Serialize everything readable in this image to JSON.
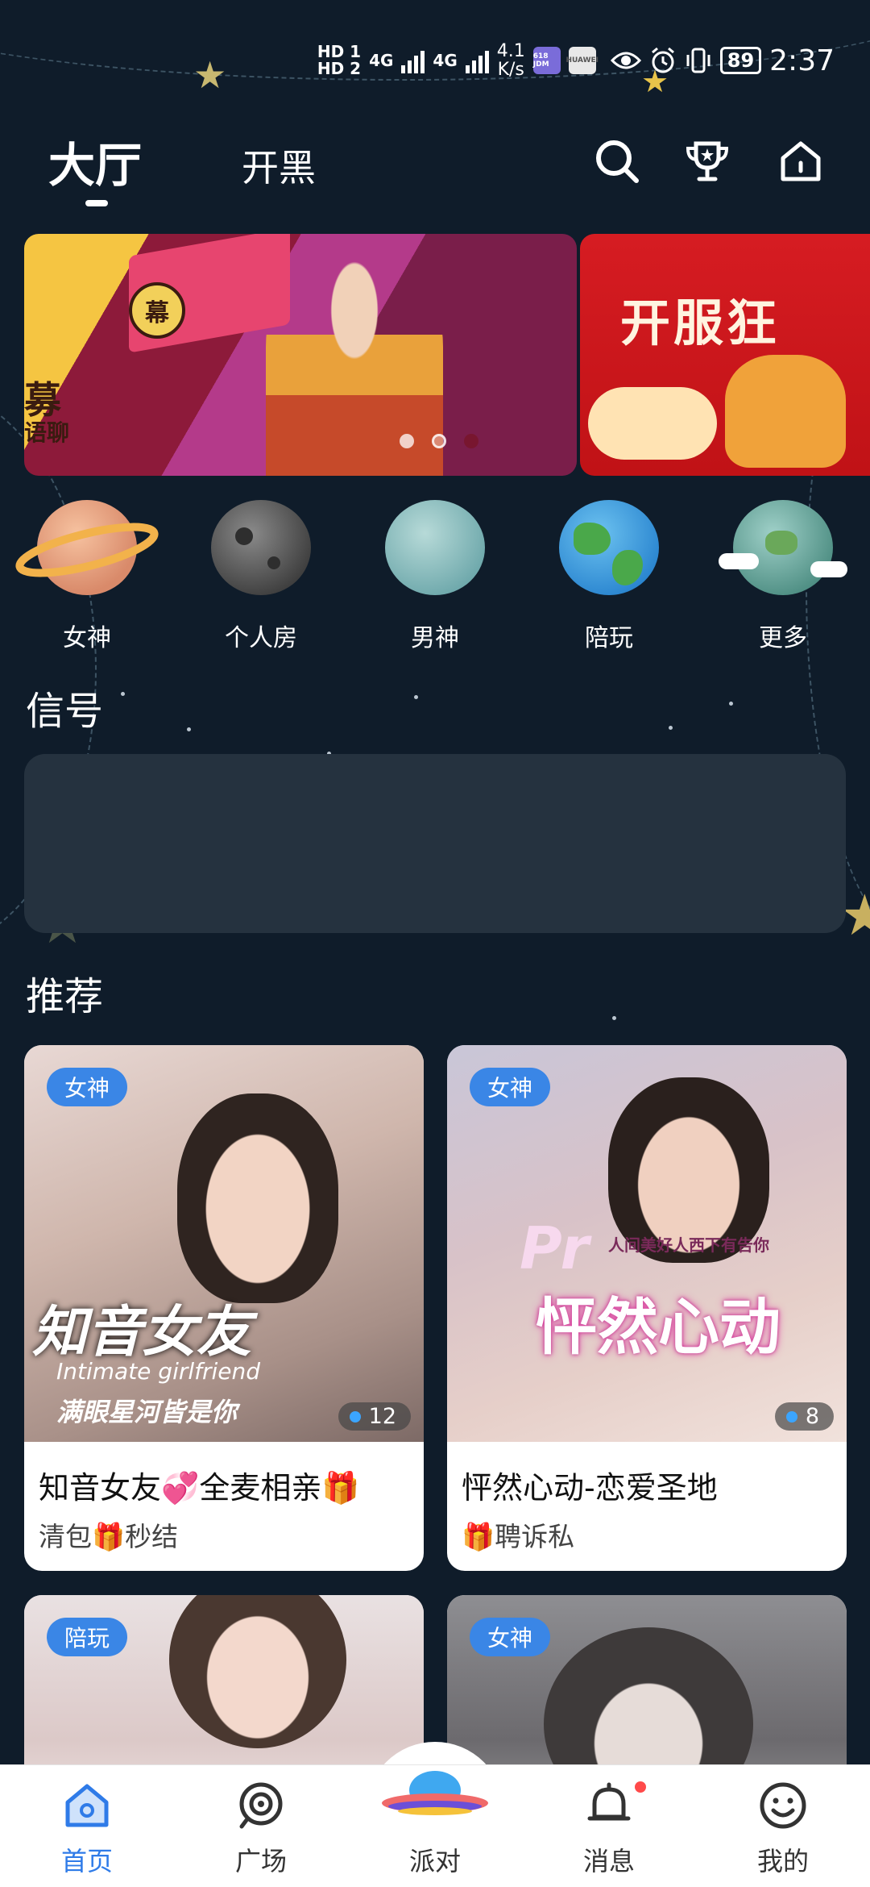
{
  "status_bar": {
    "hd1": "HD 1",
    "hd2": "HD 2",
    "net1": "4G",
    "net2": "4G",
    "speed_value": "4.1",
    "speed_unit": "K/s",
    "app1": "618 JDM",
    "app2": "HUAWEI",
    "battery": "89",
    "time": "2:37"
  },
  "top_tabs": {
    "active": "大厅",
    "second": "开黑"
  },
  "banner": {
    "main_text1": "募",
    "main_text2": "语聊",
    "main_badge": "幕",
    "next_text": "开服狂"
  },
  "categories": [
    {
      "label": "女神"
    },
    {
      "label": "个人房"
    },
    {
      "label": "男神"
    },
    {
      "label": "陪玩"
    },
    {
      "label": "更多"
    }
  ],
  "sections": {
    "signal": "信号",
    "recommend": "推荐"
  },
  "cards": [
    {
      "tag": "女神",
      "count": "12",
      "title": "知音女友💞全麦相亲🎁",
      "sub": "清包🎁秒结",
      "overlay": "知音女友",
      "overlay_sub": "Intimate girlfriend",
      "overlay_sub2": "满眼星河皆是你"
    },
    {
      "tag": "女神",
      "count": "8",
      "title": "怦然心动-恋爱圣地",
      "sub": "🎁聘诉私",
      "overlay": "怦然心动",
      "overlay_sub": "Pr",
      "overlay_sub2": "人间美好人西下有告你"
    },
    {
      "tag": "陪玩"
    },
    {
      "tag": "女神"
    }
  ],
  "bottom_nav": [
    {
      "label": "首页"
    },
    {
      "label": "广场"
    },
    {
      "label": "派对"
    },
    {
      "label": "消息"
    },
    {
      "label": "我的"
    }
  ],
  "colors": {
    "background": "#0f1c2a",
    "accent": "#2f7be8",
    "tag": "#3a86e6",
    "card": "#ffffff"
  }
}
